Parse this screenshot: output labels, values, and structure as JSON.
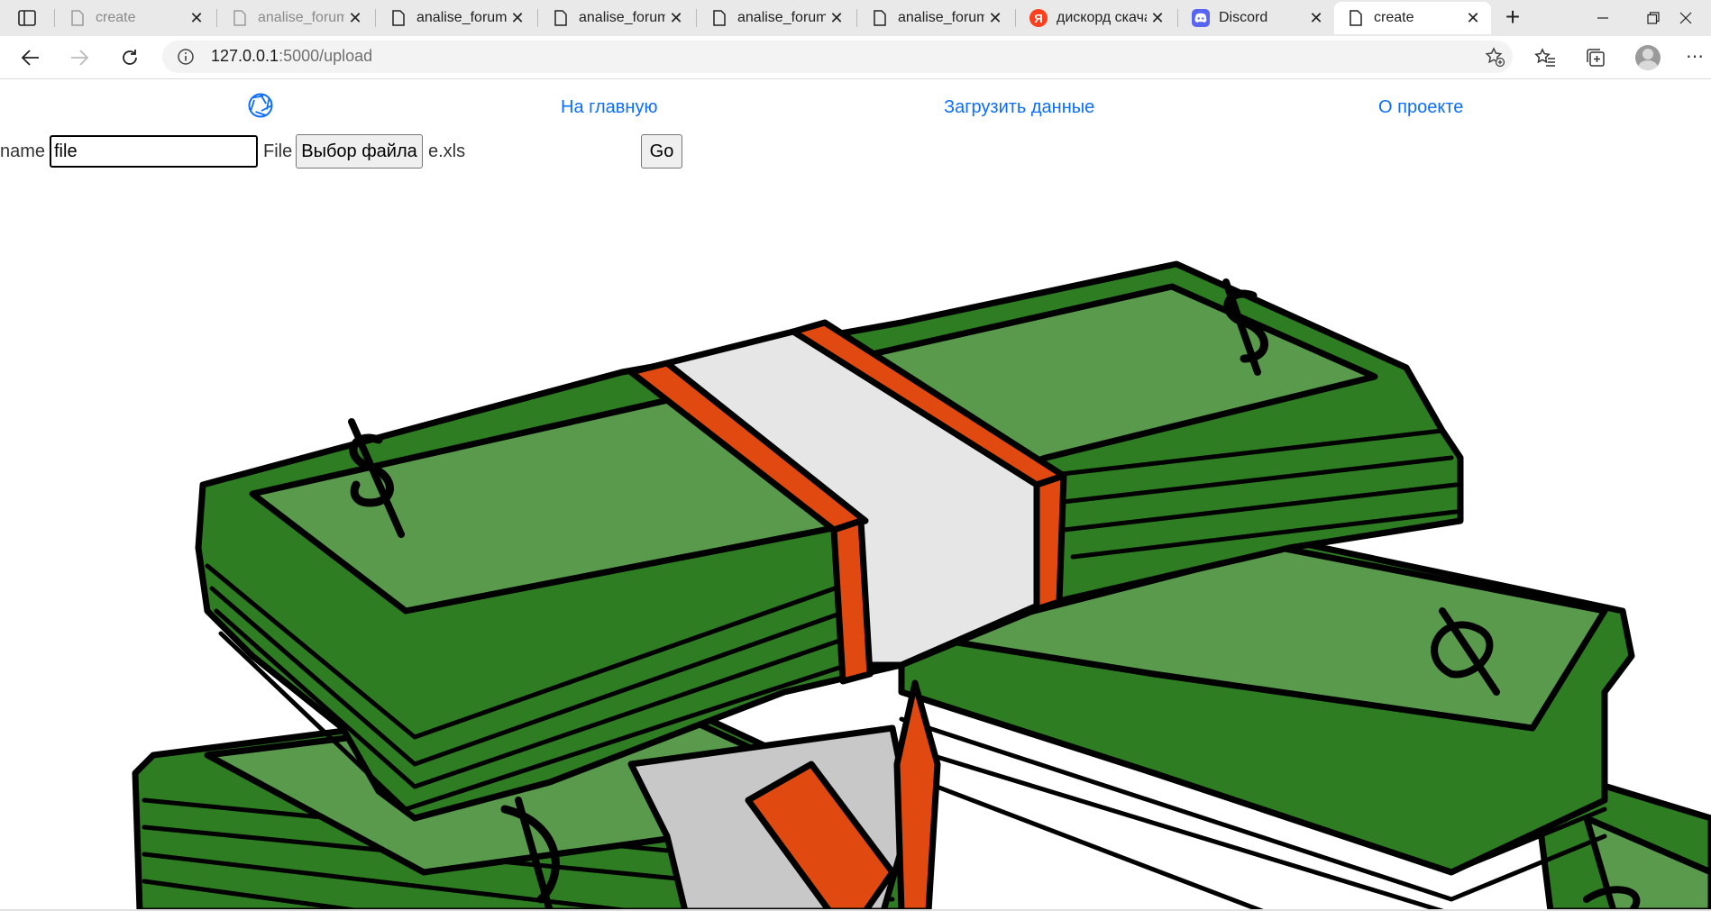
{
  "browser": {
    "tabs": [
      {
        "title": "create",
        "icon": "page-icon",
        "state": "inactive"
      },
      {
        "title": "analise_forum",
        "icon": "page-icon",
        "state": "inactive"
      },
      {
        "title": "analise_forum",
        "icon": "page-icon",
        "state": "dark"
      },
      {
        "title": "analise_forum",
        "icon": "page-icon",
        "state": "dark"
      },
      {
        "title": "analise_forum",
        "icon": "page-icon",
        "state": "dark"
      },
      {
        "title": "analise_forum",
        "icon": "page-icon",
        "state": "dark"
      },
      {
        "title": "дискорд скачать",
        "icon": "yandex-icon",
        "state": "dark"
      },
      {
        "title": "Discord",
        "icon": "discord-icon",
        "state": "dark"
      },
      {
        "title": "create",
        "icon": "page-icon",
        "state": "active"
      }
    ],
    "address": {
      "host": "127.0.0.1",
      "path": ":5000/upload"
    }
  },
  "site": {
    "nav": {
      "home": "На главную",
      "upload": "Загрузить данные",
      "about": "О проекте"
    },
    "form": {
      "name_label": "name",
      "name_value": "file",
      "file_label": "File",
      "file_button": "Выбор файла",
      "file_hint": "e.xls",
      "submit_label": "Go"
    }
  },
  "colors": {
    "link": "#0d6efd",
    "bill_green": "#2f7d23",
    "bill_face": "#5a9a4c",
    "band_orange": "#e04a10"
  }
}
